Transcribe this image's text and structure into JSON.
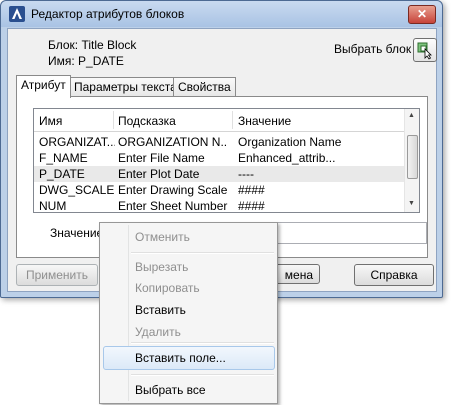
{
  "window": {
    "title": "Редактор атрибутов блоков",
    "close_label": "✕"
  },
  "block_info": {
    "block_line": "Блок: Title Block",
    "name_line": "Имя: P_DATE"
  },
  "select_block": {
    "label": "Выбрать блок"
  },
  "tabs": [
    {
      "label": "Атрибут",
      "active": true
    },
    {
      "label": "Параметры текста",
      "active": false
    },
    {
      "label": "Свойства",
      "active": false
    }
  ],
  "table": {
    "columns": [
      "Имя",
      "Подсказка",
      "Значение"
    ],
    "rows": [
      [
        "ORGANIZAT...",
        "ORGANIZATION N...",
        "Organization Name"
      ],
      [
        "F_NAME",
        "Enter File Name",
        "Enhanced_attrib..."
      ],
      [
        "P_DATE",
        "Enter Plot Date",
        "----"
      ],
      [
        "DWG_SCALE",
        "Enter Drawing Scale",
        "####"
      ],
      [
        "NUM",
        "Enter Sheet Number",
        "####"
      ]
    ],
    "selected_row": 2
  },
  "value_field": {
    "label": "Значение:",
    "value": ""
  },
  "buttons": {
    "apply": "Применить",
    "cancel_partial": "мена",
    "help": "Справка"
  },
  "context_menu": {
    "undo": "Отменить",
    "cut": "Вырезать",
    "copy": "Копировать",
    "paste": "Вставить",
    "delete": "Удалить",
    "insert_field": "Вставить поле...",
    "select_all": "Выбрать все"
  }
}
